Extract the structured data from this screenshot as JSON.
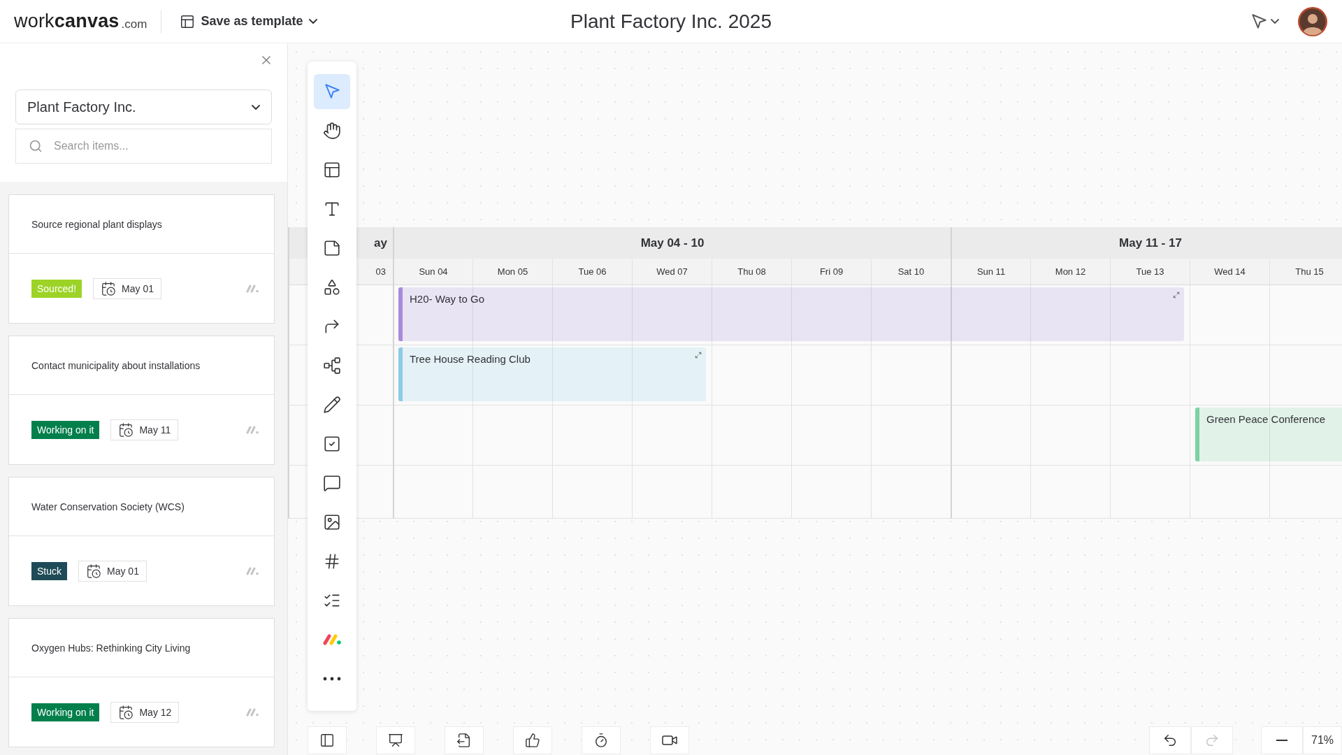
{
  "header": {
    "logo": "work**canvas**",
    "logo_suffix": ".com",
    "template_button": "Save as template",
    "title": "Plant Factory Inc. 2025"
  },
  "sidebar": {
    "board": "Plant Factory Inc.",
    "search": {
      "placeholder": "Search items..."
    },
    "items": [
      {
        "title": "Source regional plant displays",
        "status": "Sourced!",
        "color": "#9cd326",
        "date": "May 01"
      },
      {
        "title": "Contact municipality about installations",
        "status": "Working on it",
        "color": "#037f4c",
        "date": "May 11"
      },
      {
        "title": "Water Conservation Society (WCS)",
        "status": "Stuck",
        "color": "#1e4b57",
        "date": "May 01"
      },
      {
        "title": "Oxygen Hubs: Rethinking City Living",
        "status": "Working on it",
        "color": "#037f4c",
        "date": "May 12"
      }
    ]
  },
  "toolbar": {
    "tools": [
      {
        "kind": "select",
        "selected": true
      },
      {
        "kind": "hand",
        "selected": false
      },
      {
        "kind": "template",
        "selected": false
      },
      {
        "kind": "text",
        "selected": false
      },
      {
        "kind": "note",
        "selected": false
      },
      {
        "kind": "shapes",
        "selected": false
      },
      {
        "kind": "connector",
        "selected": false
      },
      {
        "kind": "mindmap",
        "selected": false
      },
      {
        "kind": "pen",
        "selected": false
      },
      {
        "kind": "task",
        "selected": false
      },
      {
        "kind": "comment",
        "selected": false
      },
      {
        "kind": "image",
        "selected": false
      },
      {
        "kind": "frame",
        "selected": false
      },
      {
        "kind": "checklist",
        "selected": false
      },
      {
        "kind": "apps",
        "selected": false
      },
      {
        "kind": "more",
        "selected": false
      }
    ]
  },
  "calendar": {
    "weeks": [
      {
        "label": "ay"
      },
      {
        "label": "May 04 - 10"
      },
      {
        "label": "May 11 - 17"
      }
    ],
    "days": [
      "03",
      "Sun 04",
      "Mon 05",
      "Tue 06",
      "Wed 07",
      "Thu 08",
      "Fri 09",
      "Sat 10",
      "Sun 11",
      "Mon 12",
      "Tue 13",
      "Wed 14",
      "Thu 15"
    ],
    "events": [
      {
        "title": "H20- Way to Go",
        "color": "#a78bda",
        "expandable": true
      },
      {
        "title": "Tree House Reading Club",
        "color": "#8ccbe6",
        "expandable": true
      },
      {
        "title": "Green Peace Conference",
        "color": "#7dd3a0",
        "expandable": false
      }
    ]
  },
  "bottom_bar": {
    "zoom": "71%"
  }
}
